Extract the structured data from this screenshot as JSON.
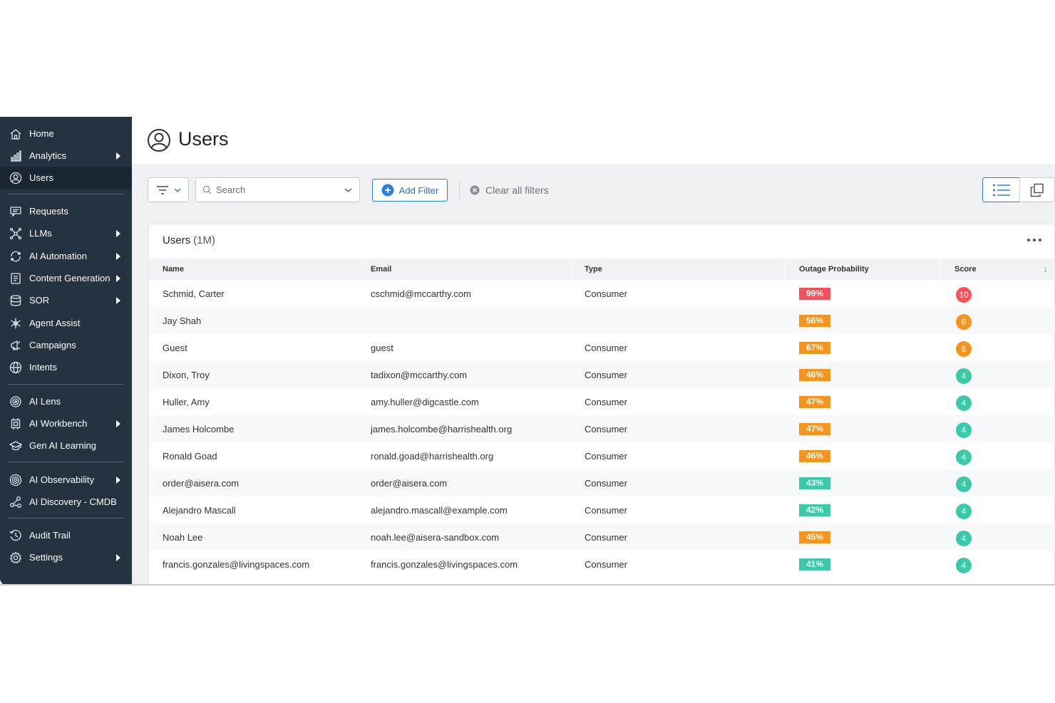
{
  "sidebar": {
    "items": [
      {
        "label": "Home",
        "icon": "home-icon",
        "caret": false,
        "active": false
      },
      {
        "label": "Analytics",
        "icon": "analytics-icon",
        "caret": true,
        "active": false
      },
      {
        "label": "Users",
        "icon": "user-icon",
        "caret": false,
        "active": true
      },
      {
        "label": "Requests",
        "icon": "chat-icon",
        "caret": false,
        "active": false
      },
      {
        "label": "LLMs",
        "icon": "network-icon",
        "caret": true,
        "active": false
      },
      {
        "label": "AI Automation",
        "icon": "cycle-icon",
        "caret": true,
        "active": false
      },
      {
        "label": "Content Generation",
        "icon": "document-icon",
        "caret": true,
        "active": false
      },
      {
        "label": "SOR",
        "icon": "database-icon",
        "caret": true,
        "active": false
      },
      {
        "label": "Agent Assist",
        "icon": "snowflake-icon",
        "caret": false,
        "active": false
      },
      {
        "label": "Campaigns",
        "icon": "megaphone-icon",
        "caret": false,
        "active": false
      },
      {
        "label": "Intents",
        "icon": "globe-icon",
        "caret": false,
        "active": false
      },
      {
        "label": "AI Lens",
        "icon": "lens-icon",
        "caret": false,
        "active": false
      },
      {
        "label": "AI Workbench",
        "icon": "chip-icon",
        "caret": true,
        "active": false
      },
      {
        "label": "Gen AI Learning",
        "icon": "graduation-cap-icon",
        "caret": false,
        "active": false
      },
      {
        "label": "AI Observability",
        "icon": "target-icon",
        "caret": true,
        "active": false
      },
      {
        "label": "AI Discovery - CMDB",
        "icon": "nodes-icon",
        "caret": false,
        "active": false
      },
      {
        "label": "Audit Trail",
        "icon": "history-icon",
        "caret": false,
        "active": false
      },
      {
        "label": "Settings",
        "icon": "gear-icon",
        "caret": true,
        "active": false
      }
    ]
  },
  "header": {
    "title": "Users"
  },
  "toolbar": {
    "search_placeholder": "Search",
    "add_filter_label": "Add Filter",
    "clear_filters_label": "Clear all filters"
  },
  "table": {
    "title": "Users",
    "count": "(1M)",
    "columns": [
      "Name",
      "Email",
      "Type",
      "Outage Probability",
      "Score"
    ],
    "rows": [
      {
        "name": "Schmid, Carter",
        "email": "cschmid@mccarthy.com",
        "type": "Consumer",
        "prob": "99%",
        "prob_color": "#f4525a",
        "score": "10",
        "score_color": "#f4525a"
      },
      {
        "name": "Jay Shah",
        "email": "",
        "type": "",
        "prob": "56%",
        "prob_color": "#f7941d",
        "score": "6",
        "score_color": "#f7941d"
      },
      {
        "name": "Guest",
        "email": "guest",
        "type": "Consumer",
        "prob": "67%",
        "prob_color": "#f7941d",
        "score": "6",
        "score_color": "#f7941d"
      },
      {
        "name": "Dixon, Troy",
        "email": "tadixon@mccarthy.com",
        "type": "Consumer",
        "prob": "46%",
        "prob_color": "#f7941d",
        "score": "4",
        "score_color": "#3cc9a7"
      },
      {
        "name": "Huller, Amy",
        "email": "amy.huller@digcastle.com",
        "type": "Consumer",
        "prob": "47%",
        "prob_color": "#f7941d",
        "score": "4",
        "score_color": "#3cc9a7"
      },
      {
        "name": "James Holcombe",
        "email": "james.holcombe@harrishealth.org",
        "type": "Consumer",
        "prob": "47%",
        "prob_color": "#f7941d",
        "score": "4",
        "score_color": "#3cc9a7"
      },
      {
        "name": "Ronald Goad",
        "email": "ronald.goad@harrishealth.org",
        "type": "Consumer",
        "prob": "46%",
        "prob_color": "#f7941d",
        "score": "4",
        "score_color": "#3cc9a7"
      },
      {
        "name": "order@aisera.com",
        "email": "order@aisera.com",
        "type": "Consumer",
        "prob": "43%",
        "prob_color": "#3cc9a7",
        "score": "4",
        "score_color": "#3cc9a7"
      },
      {
        "name": "Alejandro Mascall",
        "email": "alejandro.mascall@example.com",
        "type": "Consumer",
        "prob": "42%",
        "prob_color": "#3cc9a7",
        "score": "4",
        "score_color": "#3cc9a7"
      },
      {
        "name": "Noah Lee",
        "email": "noah.lee@aisera-sandbox.com",
        "type": "Consumer",
        "prob": "45%",
        "prob_color": "#f7941d",
        "score": "4",
        "score_color": "#3cc9a7"
      },
      {
        "name": "francis.gonzales@livingspaces.com",
        "email": "francis.gonzales@livingspaces.com",
        "type": "Consumer",
        "prob": "41%",
        "prob_color": "#3cc9a7",
        "score": "4",
        "score_color": "#3cc9a7"
      }
    ]
  },
  "colors": {
    "sidebar_bg": "#253341",
    "accent": "#2a7de1",
    "danger": "#f4525a",
    "warning": "#f7941d",
    "ok": "#3cc9a7"
  }
}
